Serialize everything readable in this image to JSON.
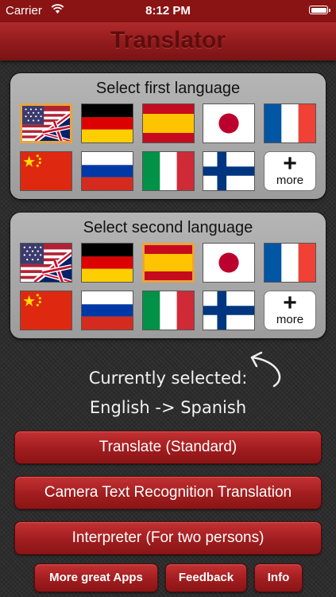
{
  "status_bar": {
    "carrier": "Carrier",
    "time": "8:12 PM"
  },
  "nav": {
    "title": "Translator"
  },
  "first_language": {
    "title": "Select first language",
    "selected": "english",
    "flags": [
      "english",
      "german",
      "spanish",
      "japanese",
      "french",
      "chinese",
      "russian",
      "italian",
      "finnish"
    ],
    "more_label": "more"
  },
  "second_language": {
    "title": "Select second language",
    "selected": "spanish",
    "flags": [
      "english",
      "german",
      "spanish",
      "japanese",
      "french",
      "chinese",
      "russian",
      "italian",
      "finnish"
    ],
    "more_label": "more"
  },
  "current": {
    "label": "Currently selected:",
    "value": "English -> Spanish"
  },
  "buttons": {
    "translate": "Translate (Standard)",
    "camera": "Camera Text Recognition Translation",
    "interpreter": "Interpreter (For two persons)",
    "more_apps": "More great Apps",
    "feedback": "Feedback",
    "info": "Info"
  },
  "colors": {
    "nav_red": "#8e1a1b",
    "selection": "#e8a43c",
    "panel_gray": "#a8a8a8"
  }
}
